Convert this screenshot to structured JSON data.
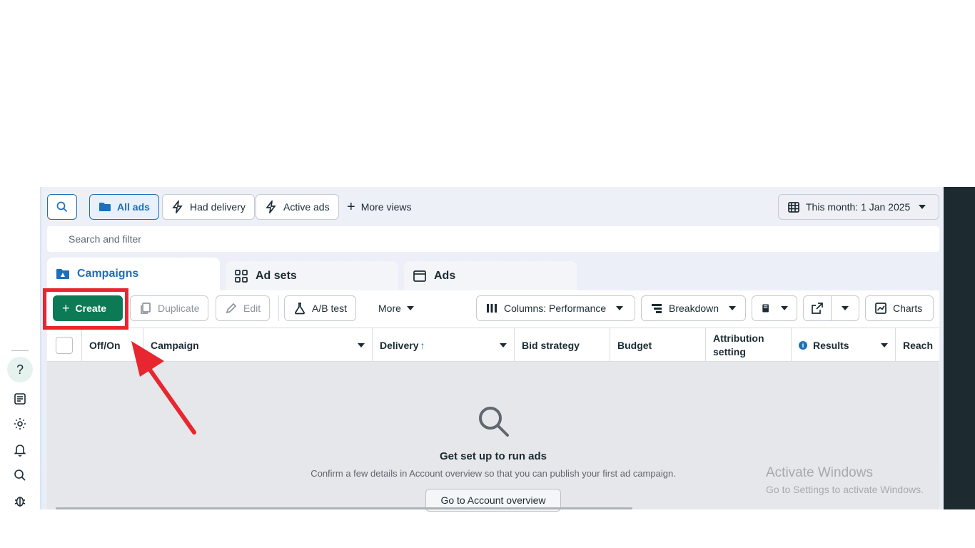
{
  "toolbar_top": {
    "all_ads": "All ads",
    "had_delivery": "Had delivery",
    "active_ads": "Active ads",
    "more_views": "More views",
    "date_range": "This month: 1 Jan 2025"
  },
  "filter": {
    "placeholder": "Search and filter"
  },
  "tabs": [
    {
      "label": "Campaigns"
    },
    {
      "label": "Ad sets"
    },
    {
      "label": "Ads"
    }
  ],
  "actions": {
    "create": "Create",
    "duplicate": "Duplicate",
    "edit": "Edit",
    "ab_test": "A/B test",
    "more": "More",
    "columns": "Columns: Performance",
    "breakdown": "Breakdown",
    "charts": "Charts"
  },
  "columns": {
    "off_on": "Off/On",
    "campaign": "Campaign",
    "delivery": "Delivery",
    "bid_strategy": "Bid strategy",
    "budget": "Budget",
    "attribution_line1": "Attribution",
    "attribution_line2": "setting",
    "results": "Results",
    "reach": "Reach"
  },
  "empty_state": {
    "title": "Get set up to run ads",
    "subtitle": "Confirm a few details in Account overview so that you can publish your first ad campaign.",
    "button": "Go to Account overview"
  },
  "watermark": {
    "line1": "Activate Windows",
    "line2": "Go to Settings to activate Windows."
  },
  "sidebar_icons": [
    "help-icon",
    "news-icon",
    "gear-icon",
    "bell-icon",
    "search-icon",
    "bug-icon"
  ],
  "colors": {
    "accent": "#1d6fb8",
    "create": "#0b7a55",
    "highlight": "#e8262f"
  }
}
